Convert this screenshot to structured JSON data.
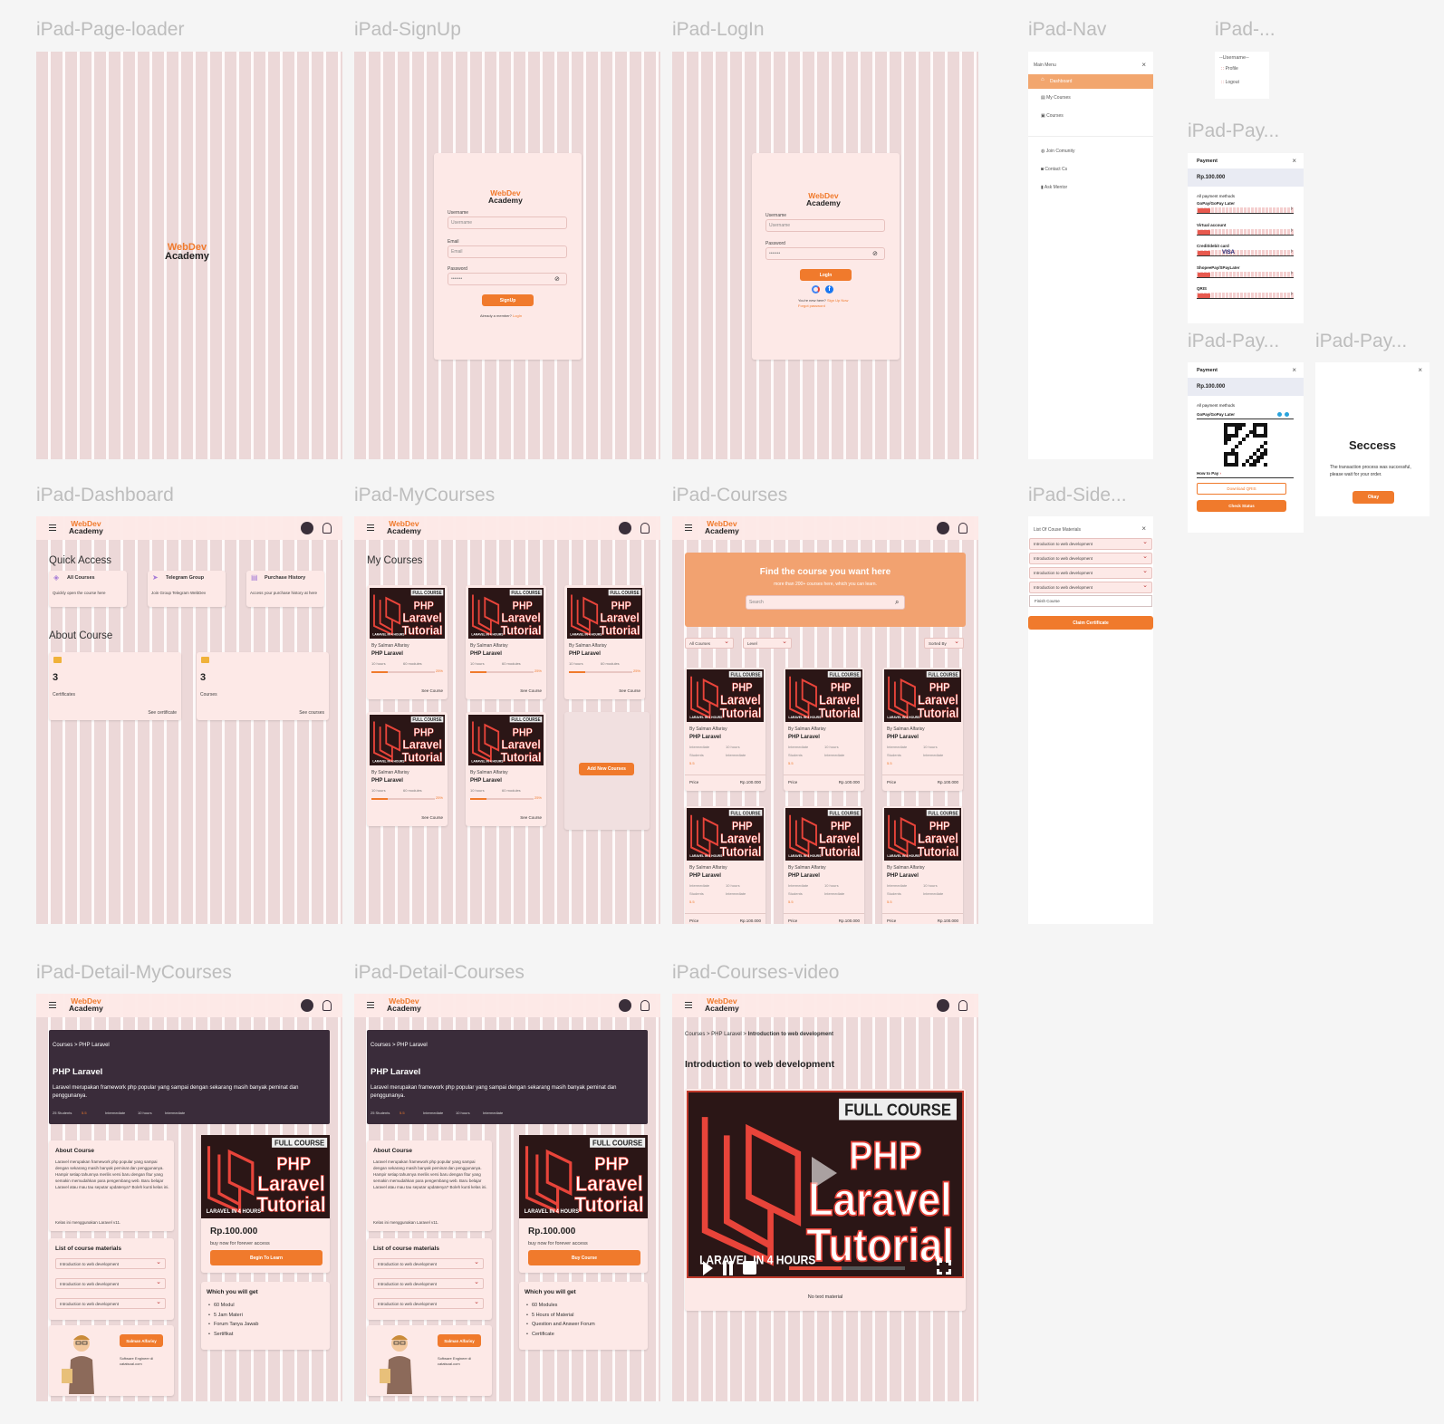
{
  "frame_labels": {
    "page_loader": "iPad-Page-loader",
    "signup": "iPad-SignUp",
    "login": "iPad-LogIn",
    "nav": "iPad-Nav",
    "user_menu": "iPad-...",
    "payment1": "iPad-Pay...",
    "payment2": "iPad-Pay...",
    "success": "iPad-Pay...",
    "dashboard": "iPad-Dashboard",
    "mycourses": "iPad-MyCourses",
    "courses": "iPad-Courses",
    "side": "iPad-Side...",
    "detail_mycourses": "iPad-Detail-MyCourses",
    "detail_courses": "iPad-Detail-Courses",
    "courses_video": "iPad-Courses-video"
  },
  "brand": {
    "line1": "WebDev",
    "line2": "Academy"
  },
  "colors": {
    "accent": "#f07a2c",
    "dark": "#3a2c3a",
    "bg": "#f5f5f5",
    "frame": "#f6dcdc"
  },
  "signup": {
    "username_label": "Username",
    "username_placeholder": "Username",
    "email_label": "Email",
    "email_placeholder": "Email",
    "password_label": "Password",
    "password_value": "•••••••",
    "button": "SignUp",
    "footer": "Already a member?",
    "footer_link": "LogIn"
  },
  "login": {
    "username_label": "Username",
    "username_placeholder": "Username",
    "password_label": "Password",
    "password_value": "•••••••",
    "button": "LogIn",
    "footer": "You're new here?",
    "footer_link": "Sign Up Now",
    "forgot": "Forgot password"
  },
  "nav": {
    "title": "Main Menu",
    "items": [
      "Dashboard",
      "My Courses",
      "Courses"
    ],
    "items2": [
      "Join Comunity",
      "Contact Cs",
      "Ask Mentor"
    ]
  },
  "user_menu": {
    "username": "--Username--",
    "items": [
      "Profile",
      "Logout"
    ]
  },
  "payment": {
    "title": "Payment",
    "amount": "Rp.100.000",
    "all_methods": "All payment methods",
    "methods": [
      "GoPay/GoPay Later",
      "Virtual account",
      "Credit/debit card",
      "ShopeePay/SPayLater",
      "QRIS"
    ],
    "visa": "VISA",
    "qr_method": "GoPay/GoPay Later",
    "how_to_pay": "How to Pay",
    "download": "Download QRIS",
    "check": "Check Status"
  },
  "success": {
    "title": "Seccess",
    "message": "The transaction process was successful, please wait for your order.",
    "button": "Okay"
  },
  "dashboard": {
    "quick_access": "Quick Access",
    "qa": [
      {
        "title": "All Courses",
        "desc": "Quickly open the course here"
      },
      {
        "title": "Telegram Group",
        "desc": "Join Group Telegram WebDev"
      },
      {
        "title": "Purchase History",
        "desc": "Access your purchase history at here"
      }
    ],
    "about": "About Course",
    "stats": [
      {
        "value": "3",
        "label": "Certificates",
        "link": "See certificate"
      },
      {
        "value": "3",
        "label": "Courses",
        "link": "See courses"
      }
    ]
  },
  "mycourses": {
    "title": "My Courses",
    "author": "By Salman Alfarisy",
    "course": "PHP Laravel",
    "hours": "10 hours",
    "modules": "60 modules",
    "progress_label": "25%",
    "progress": 0.25,
    "see": "See Course",
    "add": "Add New Courses"
  },
  "thumb": {
    "badge": "FULL COURSE",
    "line1": "PHP",
    "line2": "Laravel",
    "line3": "Tutorial",
    "small": "LARAVEL IN 4 HOURS"
  },
  "courses": {
    "hero_title": "Find the course you want here",
    "hero_sub": "more than 200+ courses here, which you can learn.",
    "search": "Search",
    "filters": [
      "All Courses",
      "Level"
    ],
    "sort": "Sorted By",
    "author": "By Salman Alfarisy",
    "course": "PHP Laravel",
    "level": "Intermediate",
    "hours": "10 hours",
    "students": "Students",
    "rating": "5.5",
    "price_label": "Price",
    "price": "Rp.100.000"
  },
  "side": {
    "title": "List Of Couse Materials",
    "items": [
      "Introduction to web development",
      "Introduction to web development",
      "Introduction to web development",
      "Introduction to web development"
    ],
    "finish": "Finish Course",
    "claim": "Claim Certificate"
  },
  "detail": {
    "breadcrumb": "Courses > PHP Laravel",
    "title": "PHP Laravel",
    "desc": "Laravel merupakan framework php popular yang sampai dengan sekarang masih banyak peminat dan penggunanya.",
    "meta": [
      "25 Students",
      "5.5",
      "Intermediate",
      "10 hours",
      "Intermediate"
    ],
    "about_title": "About Course",
    "about_text": "Laravel merupakan framework php popular yang sampai dengan sekarang masih banyak peminat dan penggunanya. Hampir setiap tahunnya merilis versi baru dengan fitur yang semakin memudahkan para pengembang web. Baru belajar Laravel atau mau tau seputar updatenya? Boleh kunti kelas ini.",
    "about_text2": "Kelas ini menggunakan Laravel v11.",
    "list_title": "List of course materials",
    "list_items": [
      "Introduction to web development",
      "Introduction to web development",
      "Introduction to web development"
    ],
    "price": "Rp.100.000",
    "price_sub": "buy now for forever access",
    "btn_my": "Begin To Learn",
    "btn_buy": "Buy Course",
    "get_title": "Which you will get",
    "get_my": [
      "60 Modul",
      "5 Jam Materi",
      "Forum Tanya Jawab",
      "Sertifikat"
    ],
    "get_buy": [
      "60 Modules",
      "5 Hours of Material",
      "Question and Answer Forum",
      "Certificate"
    ],
    "mentor": "Salman Alfarisy",
    "mentor_desc": "Software Engineer di catatsoal.com"
  },
  "video": {
    "breadcrumb_a": "Courses > PHP Laravel >",
    "breadcrumb_b": "Introduction to web development",
    "title": "Introduction to web development",
    "no_text": "No text material",
    "progress": 0.45
  }
}
